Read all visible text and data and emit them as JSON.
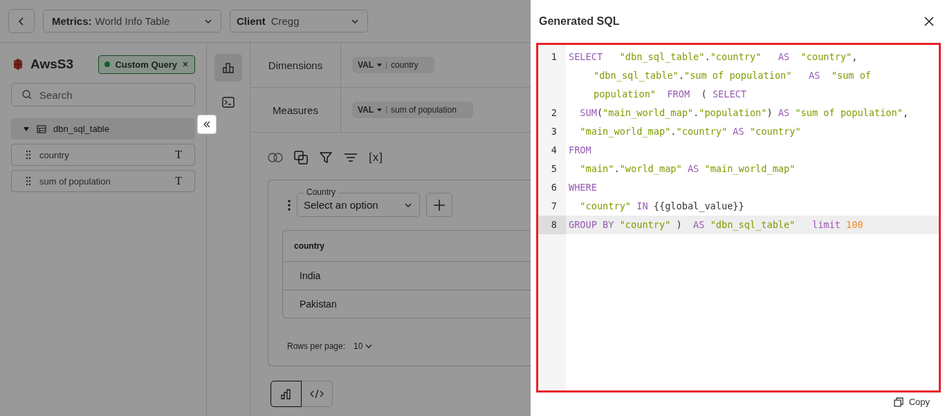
{
  "topbar": {
    "metric": {
      "label": "Metrics:",
      "value": "World Info Table"
    },
    "client": {
      "label": "Client",
      "value": "Cregg"
    }
  },
  "sidebar": {
    "source": "AwsS3",
    "badge": {
      "label": "Custom Query"
    },
    "search": {
      "placeholder": "Search"
    },
    "table": {
      "name": "dbn_sql_table",
      "expanded": true,
      "children": [
        {
          "name": "country",
          "type_symbol": "T"
        },
        {
          "name": "sum of population",
          "type_symbol": "T"
        }
      ]
    }
  },
  "rail": [
    {
      "kind": "chart",
      "selected": true
    },
    {
      "kind": "terminal",
      "selected": false
    }
  ],
  "shelves": [
    {
      "label": "Dimensions",
      "pills": [
        {
          "prefix": "VAL",
          "value": "country"
        }
      ]
    },
    {
      "label": "Measures",
      "pills": [
        {
          "prefix": "VAL",
          "value": "sum of population"
        }
      ]
    }
  ],
  "toolbar": {
    "variables_label": "[x]"
  },
  "filter": {
    "label": "Country",
    "placeholder": "Select an option"
  },
  "table": {
    "columns": [
      "country"
    ],
    "rows": [
      [
        "India"
      ],
      [
        "Pakistan"
      ]
    ]
  },
  "pagination": {
    "label": "Rows per page:",
    "value": "10"
  },
  "view_toggle": [
    {
      "kind": "chart",
      "selected": true
    },
    {
      "kind": "code",
      "selected": false
    }
  ],
  "drawer": {
    "title": "Generated SQL",
    "copy_label": "Copy",
    "lines": [
      {
        "number": "1",
        "active": false,
        "wraps": [
          {
            "tokens": [
              {
                "kind": "keyword",
                "text": "SELECT   "
              },
              {
                "kind": "string",
                "text": "\"dbn_sql_table\""
              },
              {
                "kind": "plain",
                "text": "."
              },
              {
                "kind": "string",
                "text": "\"country\"   "
              },
              {
                "kind": "keyword",
                "text": "AS  "
              },
              {
                "kind": "string",
                "text": "\"country\""
              },
              {
                "kind": "plain",
                "text": ","
              }
            ]
          },
          {
            "tokens": [
              {
                "kind": "string",
                "text": "\"dbn_sql_table\""
              },
              {
                "kind": "plain",
                "text": "."
              },
              {
                "kind": "string",
                "text": "\"sum of population\"   "
              },
              {
                "kind": "keyword",
                "text": "AS  "
              },
              {
                "kind": "string",
                "text": "\"sum of"
              }
            ]
          },
          {
            "tokens": [
              {
                "kind": "string",
                "text": "population\"  "
              },
              {
                "kind": "keyword",
                "text": "FROM  "
              },
              {
                "kind": "plain",
                "text": "( "
              },
              {
                "kind": "keyword",
                "text": "SELECT"
              }
            ]
          }
        ]
      },
      {
        "number": "2",
        "active": false,
        "wraps": [
          {
            "tokens": [
              {
                "kind": "keyword",
                "text": "  SUM"
              },
              {
                "kind": "plain",
                "text": "("
              },
              {
                "kind": "string",
                "text": "\"main_world_map\""
              },
              {
                "kind": "plain",
                "text": "."
              },
              {
                "kind": "string",
                "text": "\"population\""
              },
              {
                "kind": "plain",
                "text": ") "
              },
              {
                "kind": "keyword",
                "text": "AS "
              },
              {
                "kind": "string",
                "text": "\"sum of population\""
              },
              {
                "kind": "plain",
                "text": ","
              }
            ]
          }
        ]
      },
      {
        "number": "3",
        "active": false,
        "wraps": [
          {
            "tokens": [
              {
                "kind": "string",
                "text": "  \"main_world_map\""
              },
              {
                "kind": "plain",
                "text": "."
              },
              {
                "kind": "string",
                "text": "\"country\" "
              },
              {
                "kind": "keyword",
                "text": "AS "
              },
              {
                "kind": "string",
                "text": "\"country\""
              }
            ]
          }
        ]
      },
      {
        "number": "4",
        "active": false,
        "wraps": [
          {
            "tokens": [
              {
                "kind": "keyword",
                "text": "FROM"
              }
            ]
          }
        ]
      },
      {
        "number": "5",
        "active": false,
        "wraps": [
          {
            "tokens": [
              {
                "kind": "string",
                "text": "  \"main\""
              },
              {
                "kind": "plain",
                "text": "."
              },
              {
                "kind": "string",
                "text": "\"world_map\" "
              },
              {
                "kind": "keyword",
                "text": "AS "
              },
              {
                "kind": "string",
                "text": "\"main_world_map\""
              }
            ]
          }
        ]
      },
      {
        "number": "6",
        "active": false,
        "wraps": [
          {
            "tokens": [
              {
                "kind": "keyword",
                "text": "WHERE"
              }
            ]
          }
        ]
      },
      {
        "number": "7",
        "active": false,
        "wraps": [
          {
            "tokens": [
              {
                "kind": "string",
                "text": "  \"country\" "
              },
              {
                "kind": "keyword",
                "text": "IN "
              },
              {
                "kind": "plain",
                "text": "{{global_value}}"
              }
            ]
          }
        ]
      },
      {
        "number": "8",
        "active": true,
        "wraps": [
          {
            "tokens": [
              {
                "kind": "keyword",
                "text": "GROUP BY "
              },
              {
                "kind": "string",
                "text": "\"country\" "
              },
              {
                "kind": "plain",
                "text": ")  "
              },
              {
                "kind": "keyword",
                "text": "AS "
              },
              {
                "kind": "string",
                "text": "\"dbn_sql_table\"   "
              },
              {
                "kind": "keyword",
                "text": "limit "
              },
              {
                "kind": "number",
                "text": "100"
              }
            ]
          }
        ]
      }
    ]
  }
}
